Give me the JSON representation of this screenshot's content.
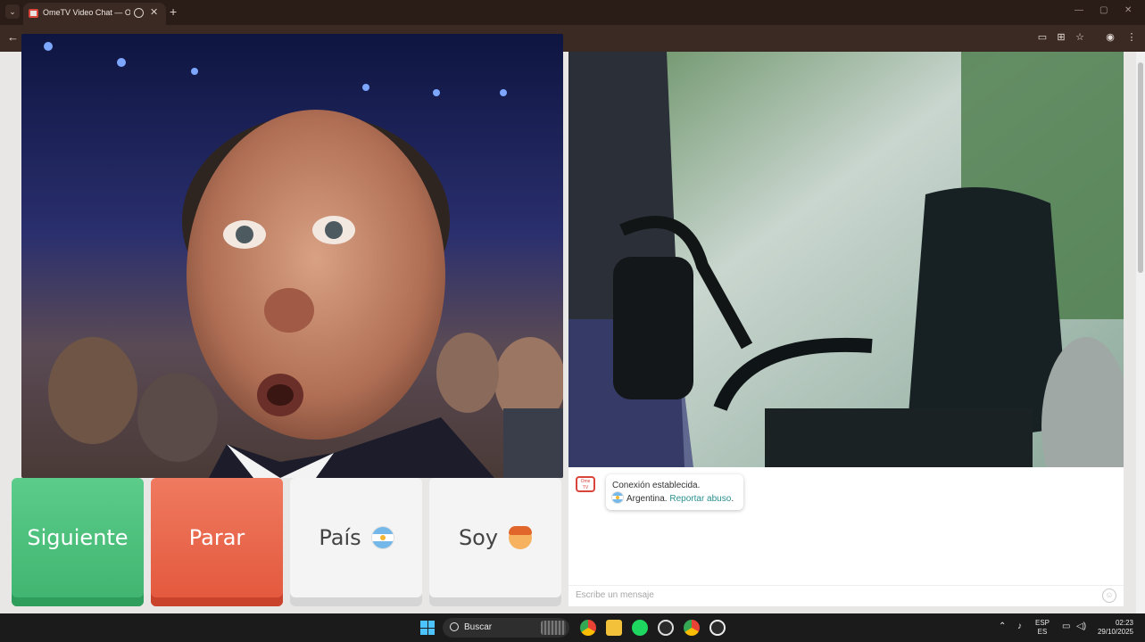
{
  "browser": {
    "tab_title": "OmeTV Video Chat — Ome",
    "tab_close": "✕",
    "new_tab": "+",
    "window_controls": [
      "—",
      "▢",
      "✕"
    ]
  },
  "buttons": {
    "next": "Siguiente",
    "stop": "Parar",
    "country": "País",
    "iam": "Soy"
  },
  "chat": {
    "logo_text": "Ome TV",
    "message_line1": "Conexión establecida.",
    "country_name": "Argentina.",
    "report_link": "Reportar abuso",
    "report_suffix": ".",
    "input_placeholder": "Escribe un mensaje"
  },
  "taskbar": {
    "search_text": "Buscar",
    "lang_top": "ESP",
    "lang_bottom": "ES",
    "time": "02:23",
    "date": "29/10/2025"
  },
  "colors": {
    "next": "#4cc07b",
    "stop": "#e8644a",
    "link": "#2a8f8f",
    "browser_chrome": "#3b2a23"
  }
}
